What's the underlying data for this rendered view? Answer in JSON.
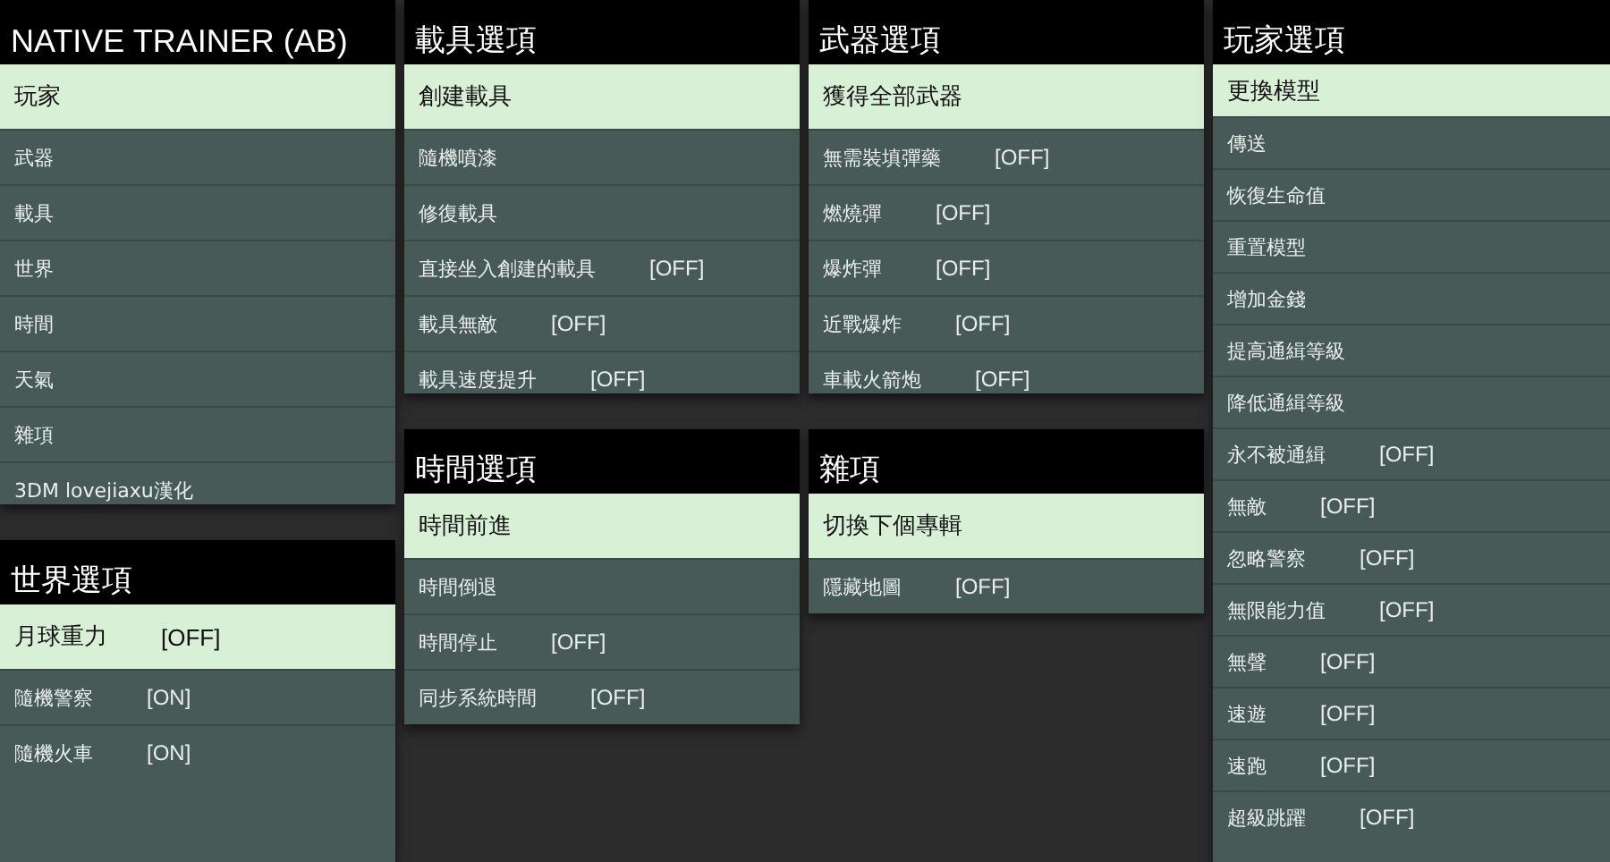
{
  "columns": [
    {
      "panels": [
        {
          "title": "NATIVE TRAINER (AB)",
          "kind": "main",
          "items": [
            {
              "label": "玩家",
              "selected": true
            },
            {
              "label": "武器",
              "selected": false
            },
            {
              "label": "載具",
              "selected": false
            },
            {
              "label": "世界",
              "selected": false
            },
            {
              "label": "時間",
              "selected": false
            },
            {
              "label": "天氣",
              "selected": false
            },
            {
              "label": "雜項",
              "selected": false
            },
            {
              "label": "3DM lovejiaxu漢化",
              "selected": false
            }
          ]
        },
        {
          "title": "世界選項",
          "kind": "sub",
          "items": [
            {
              "label": "月球重力",
              "value": "[OFF]",
              "selected": true
            },
            {
              "label": "隨機警察",
              "value": "[ON]",
              "selected": false
            },
            {
              "label": "隨機火車",
              "value": "[ON]",
              "selected": false
            }
          ]
        }
      ]
    },
    {
      "panels": [
        {
          "title": "載具選項",
          "kind": "sub",
          "items": [
            {
              "label": "創建載具",
              "selected": true
            },
            {
              "label": "隨機噴漆",
              "selected": false
            },
            {
              "label": "修復載具",
              "selected": false
            },
            {
              "label": "直接坐入創建的載具",
              "value": "[OFF]",
              "selected": false
            },
            {
              "label": "載具無敵",
              "value": "[OFF]",
              "selected": false
            },
            {
              "label": "載具速度提升",
              "value": "[OFF]",
              "selected": false
            }
          ]
        },
        {
          "title": "時間選項",
          "kind": "sub",
          "items": [
            {
              "label": "時間前進",
              "selected": true
            },
            {
              "label": "時間倒退",
              "selected": false
            },
            {
              "label": "時間停止",
              "value": "[OFF]",
              "selected": false
            },
            {
              "label": "同步系統時間",
              "value": "[OFF]",
              "selected": false
            }
          ]
        }
      ]
    },
    {
      "panels": [
        {
          "title": "武器選項",
          "kind": "sub",
          "items": [
            {
              "label": "獲得全部武器",
              "selected": true
            },
            {
              "label": "無需裝填彈藥",
              "value": "[OFF]",
              "selected": false
            },
            {
              "label": "燃燒彈",
              "value": "[OFF]",
              "selected": false
            },
            {
              "label": "爆炸彈",
              "value": "[OFF]",
              "selected": false
            },
            {
              "label": "近戰爆炸",
              "value": "[OFF]",
              "selected": false
            },
            {
              "label": "車載火箭炮",
              "value": "[OFF]",
              "selected": false
            }
          ]
        },
        {
          "title": "雜項",
          "kind": "sub",
          "items": [
            {
              "label": "切換下個專輯",
              "selected": true
            },
            {
              "label": "隱藏地圖",
              "value": "[OFF]",
              "selected": false
            }
          ]
        }
      ]
    },
    {
      "panels": [
        {
          "title": "玩家選項",
          "kind": "sub",
          "items": [
            {
              "label": "更換模型",
              "selected": true
            },
            {
              "label": "傳送",
              "selected": false
            },
            {
              "label": "恢復生命值",
              "selected": false
            },
            {
              "label": "重置模型",
              "selected": false
            },
            {
              "label": "增加金錢",
              "selected": false
            },
            {
              "label": "提高通緝等級",
              "selected": false
            },
            {
              "label": "降低通緝等級",
              "selected": false
            },
            {
              "label": "永不被通緝",
              "value": "[OFF]",
              "selected": false
            },
            {
              "label": "無敵",
              "value": "[OFF]",
              "selected": false
            },
            {
              "label": "忽略警察",
              "value": "[OFF]",
              "selected": false
            },
            {
              "label": "無限能力值",
              "value": "[OFF]",
              "selected": false
            },
            {
              "label": "無聲",
              "value": "[OFF]",
              "selected": false
            },
            {
              "label": "速遊",
              "value": "[OFF]",
              "selected": false
            },
            {
              "label": "速跑",
              "value": "[OFF]",
              "selected": false
            },
            {
              "label": "超級跳躍",
              "value": "[OFF]",
              "selected": false
            }
          ]
        }
      ]
    }
  ]
}
